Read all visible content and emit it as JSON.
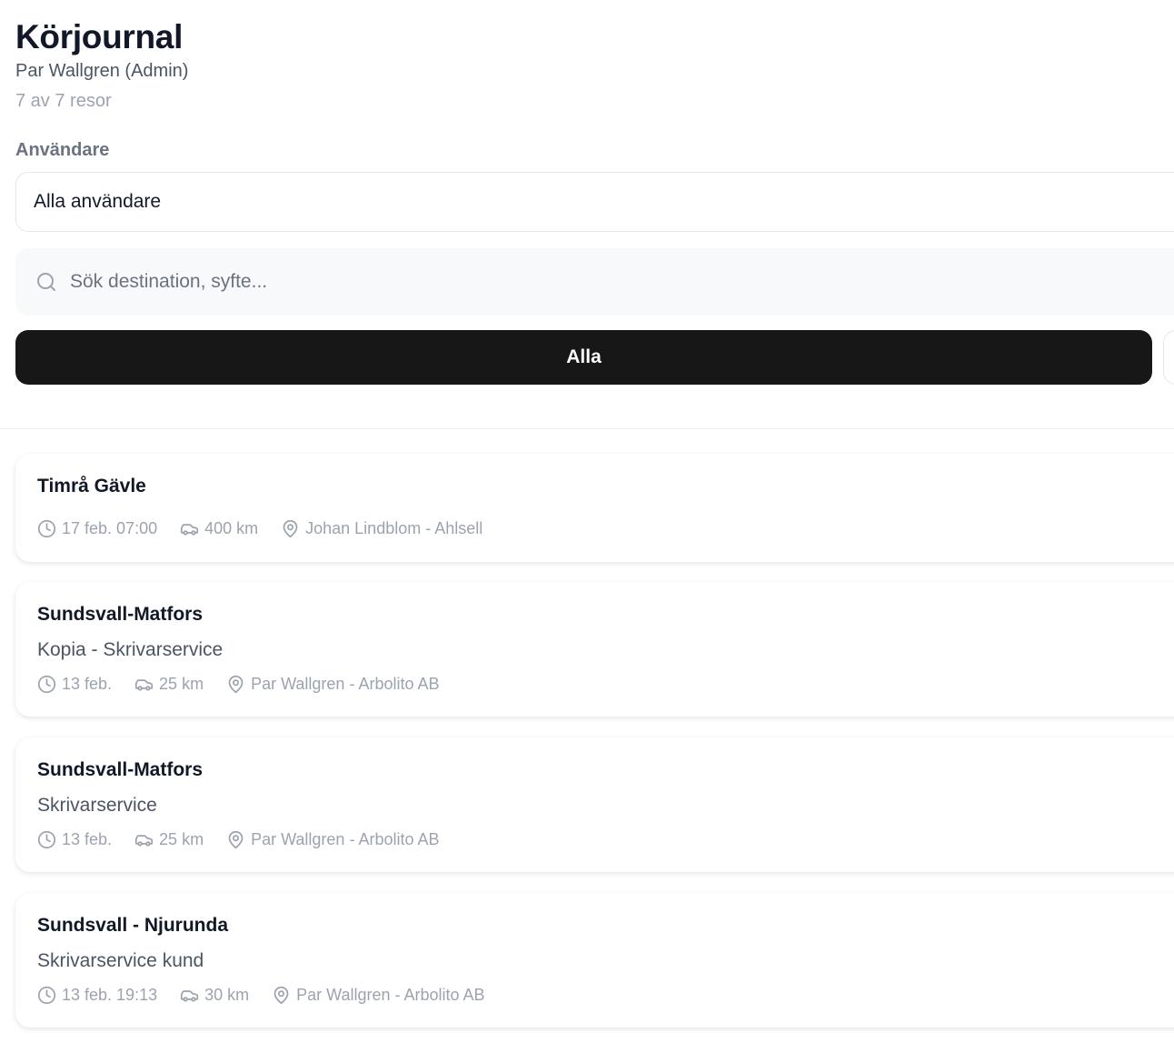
{
  "header": {
    "title": "Körjournal",
    "subtitle": "Par Wallgren (Admin)",
    "count": "7 av 7 resor"
  },
  "filter": {
    "label": "Användare",
    "selected": "Alla användare"
  },
  "search": {
    "placeholder": "Sök destination, syfte...",
    "value": ""
  },
  "tabs": {
    "active_label": "Alla"
  },
  "trips": [
    {
      "title": "Timrå Gävle",
      "purpose": "",
      "date": "17 feb. 07:00",
      "distance": "400 km",
      "location": "Johan Lindblom - Ahlsell"
    },
    {
      "title": "Sundsvall-Matfors",
      "purpose": "Kopia - Skrivarservice",
      "date": "13 feb.",
      "distance": "25 km",
      "location": "Par Wallgren - Arbolito AB"
    },
    {
      "title": "Sundsvall-Matfors",
      "purpose": "Skrivarservice",
      "date": "13 feb.",
      "distance": "25 km",
      "location": "Par Wallgren - Arbolito AB"
    },
    {
      "title": "Sundsvall - Njurunda",
      "purpose": "Skrivarservice kund",
      "date": "13 feb. 19:13",
      "distance": "30 km",
      "location": "Par Wallgren - Arbolito AB"
    }
  ],
  "icons": {
    "search": "search-icon",
    "time": "clock-icon",
    "distance": "car-icon",
    "location": "map-pin-icon"
  },
  "colors": {
    "primary_button": "#171717",
    "muted_text": "#9ca3af"
  }
}
